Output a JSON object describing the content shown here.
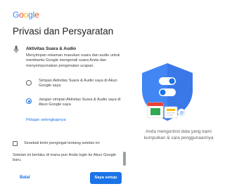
{
  "logo": {
    "letters": [
      "G",
      "o",
      "o",
      "g",
      "l",
      "e"
    ]
  },
  "page_title": "Privasi dan Persyaratan",
  "section": {
    "title": "Aktivitas Suara & Audio",
    "description": "Menyimpan rekaman masukan suara dan audio untuk membantu Google mengenali suara Anda dan menyempurnakan pengenalan ucapan.",
    "icon": "mic-icon"
  },
  "options": [
    {
      "label": "Simpan Aktivitas Suara & Audio saya di Akun Google saya",
      "checked": false
    },
    {
      "label": "Jangan simpan Aktivitas Suara & Audio saya di Akun Google saya",
      "checked": true
    }
  ],
  "learn_more": "Pelajari selengkapnya",
  "reminder_checkbox": {
    "label": "Sesekali kirim pengingat tentang setelan ini",
    "checked": false
  },
  "note": "Setelan ini berlaku di mana pun Anda login ke Akun Google baru.",
  "caption": "Anda mengontrol data yang kami kumpulkan & cara penggunaannya",
  "buttons": {
    "cancel": "Batal",
    "agree": "Saya setuju"
  },
  "colors": {
    "accent": "#1a73e8",
    "shield": "#4285f4",
    "text": "#202124"
  }
}
